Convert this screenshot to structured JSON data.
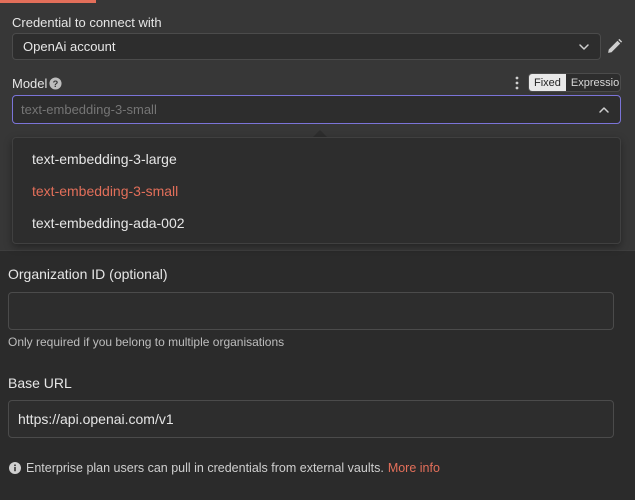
{
  "colors": {
    "accent": "#e36f5a",
    "focus_border": "#7b74d8",
    "panel_bg": "#373737",
    "page_bg": "#2b2b2b"
  },
  "credential": {
    "label": "Credential to connect with",
    "value": "OpenAi account",
    "edit_icon": "pencil-icon"
  },
  "model": {
    "label": "Model",
    "help_icon": "question-circle-icon",
    "options_menu_icon": "kebab-icon",
    "mode_toggle": {
      "options": [
        "Fixed",
        "Expression"
      ],
      "active": "Fixed"
    },
    "input_value": "",
    "input_placeholder": "text-embedding-3-small",
    "dropdown": {
      "options": [
        "text-embedding-3-large",
        "text-embedding-3-small",
        "text-embedding-ada-002"
      ],
      "selected": "text-embedding-3-small"
    }
  },
  "organization": {
    "label": "Organization ID (optional)",
    "value": "",
    "hint": "Only required if you belong to multiple organisations"
  },
  "base_url": {
    "label": "Base URL",
    "value": "https://api.openai.com/v1"
  },
  "notice": {
    "icon": "info-circle-icon",
    "text": "Enterprise plan users can pull in credentials from external vaults.",
    "link": "More info"
  }
}
